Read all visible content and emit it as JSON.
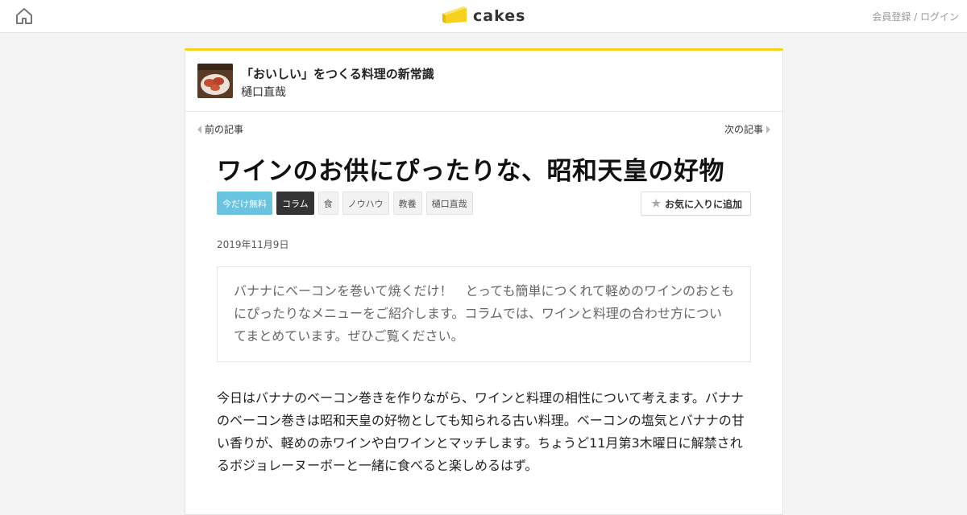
{
  "header": {
    "home_icon": "home-icon",
    "logo_text": "cakes",
    "logo_icon": "cheese-cake-icon",
    "member_links": "会員登録 / ログイン"
  },
  "series": {
    "title": "「おいしい」をつくる料理の新常識",
    "author": "樋口直哉"
  },
  "nav": {
    "prev_label": "前の記事",
    "next_label": "次の記事"
  },
  "article": {
    "title": "ワインのお供にぴったりな、昭和天皇の好物",
    "tags": [
      "今だけ無料",
      "コラム",
      "食",
      "ノウハウ",
      "教養",
      "樋口直哉"
    ],
    "favorite_label": "お気に入りに追加",
    "date": "2019年11月9日",
    "lead": "バナナにベーコンを巻いて焼くだけ！　とっても簡単につくれて軽めのワインのおともにぴったりなメニューをご紹介します。コラムでは、ワインと料理の合わせ方についてまとめています。ぜひご覧ください。",
    "body": "今日はバナナのベーコン巻きを作りながら、ワインと料理の相性について考えます。バナナのベーコン巻きは昭和天皇の好物としても知られる古い料理。ベーコンの塩気とバナナの甘い香りが、軽めの赤ワインや白ワインとマッチします。ちょうど11月第3木曜日に解禁されるボジョレーヌーボーと一緒に食べると楽しめるはず。"
  },
  "colors": {
    "accent_yellow": "#f7d21c",
    "free_tag": "#6ac3e0",
    "column_tag": "#333333"
  }
}
